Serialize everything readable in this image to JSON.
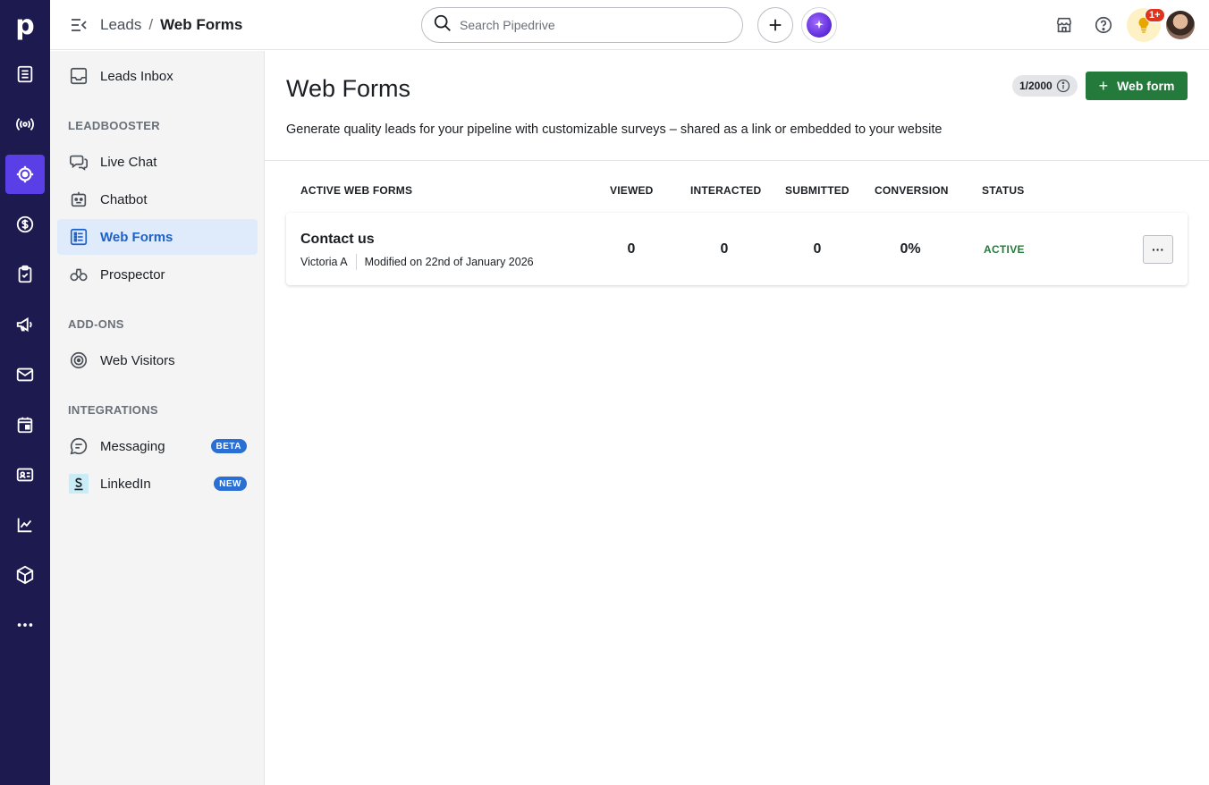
{
  "app": {
    "logo_letter": "p"
  },
  "rail": {
    "items": [
      {
        "name": "deals-icon"
      },
      {
        "name": "leads-icon",
        "active": false
      },
      {
        "name": "leads-target-icon",
        "active": true
      },
      {
        "name": "revenue-icon"
      },
      {
        "name": "activities-icon"
      },
      {
        "name": "campaigns-icon"
      },
      {
        "name": "mail-icon"
      },
      {
        "name": "calendar-icon"
      },
      {
        "name": "contacts-icon"
      },
      {
        "name": "insights-icon"
      },
      {
        "name": "products-icon"
      },
      {
        "name": "more-icon"
      }
    ]
  },
  "header": {
    "breadcrumb_parent": "Leads",
    "breadcrumb_sep": "/",
    "breadcrumb_current": "Web Forms",
    "search_placeholder": "Search Pipedrive",
    "notification_badge": "1+"
  },
  "sidebar": {
    "inbox_label": "Leads Inbox",
    "section_leadbooster": "LEADBOOSTER",
    "live_chat": "Live Chat",
    "chatbot": "Chatbot",
    "web_forms": "Web Forms",
    "prospector": "Prospector",
    "section_addons": "ADD-ONS",
    "web_visitors": "Web Visitors",
    "section_integrations": "INTEGRATIONS",
    "messaging": "Messaging",
    "messaging_badge": "BETA",
    "linkedin": "LinkedIn",
    "linkedin_badge": "NEW"
  },
  "main": {
    "title": "Web Forms",
    "quota": "1/2000",
    "add_button": "Web form",
    "subtitle": "Generate quality leads for your pipeline with customizable surveys – shared as a link or embedded to your website",
    "columns": [
      "ACTIVE WEB FORMS",
      "VIEWED",
      "INTERACTED",
      "SUBMITTED",
      "CONVERSION",
      "STATUS"
    ],
    "rows": [
      {
        "name": "Contact us",
        "owner": "Victoria A",
        "modified": "Modified on 22nd of January 2026",
        "viewed": "0",
        "interacted": "0",
        "submitted": "0",
        "conversion": "0%",
        "status": "ACTIVE",
        "more": "···"
      }
    ]
  },
  "colors": {
    "rail_bg": "#1d1a4f",
    "rail_active": "#5a3ee6",
    "primary_green": "#237a3b",
    "active_blue": "#1d62c8",
    "badge_blue": "#2a6fd3",
    "badge_red": "#e0321c"
  }
}
